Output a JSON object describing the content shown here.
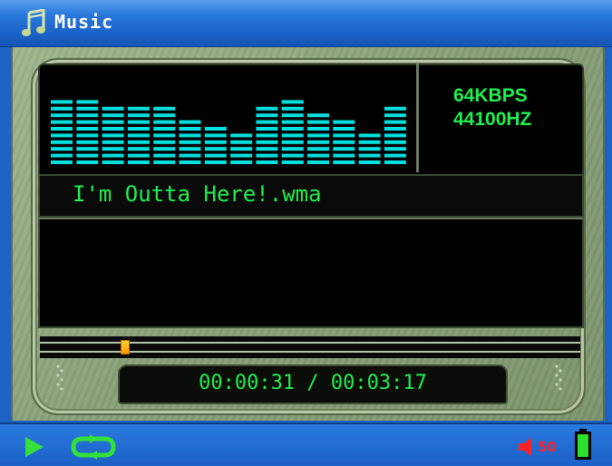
{
  "window": {
    "title": "Music",
    "icon": "music-notes-icon"
  },
  "now_playing": {
    "bitrate": "64KBPS",
    "sample_rate": "44100HZ",
    "song_title": "I'm Outta Here!.wma",
    "time_display": "00:00:31 / 00:03:17",
    "progress_fraction": 0.157
  },
  "equalizer": {
    "bar_levels": [
      10,
      10,
      9,
      9,
      9,
      7,
      6,
      5,
      9,
      10,
      8,
      7,
      5,
      9
    ]
  },
  "status_bar": {
    "play_state_icon": "play-icon",
    "repeat_icon": "repeat-icon",
    "volume_icon": "speaker-icon",
    "volume_level": "50",
    "battery_icon": "battery-full-icon"
  },
  "colors": {
    "display_text": "#20f050",
    "equalizer": "#00e0e0",
    "titlebar": "#2a79dc",
    "volume": "#ff2222",
    "battery": "#2ce02c"
  }
}
